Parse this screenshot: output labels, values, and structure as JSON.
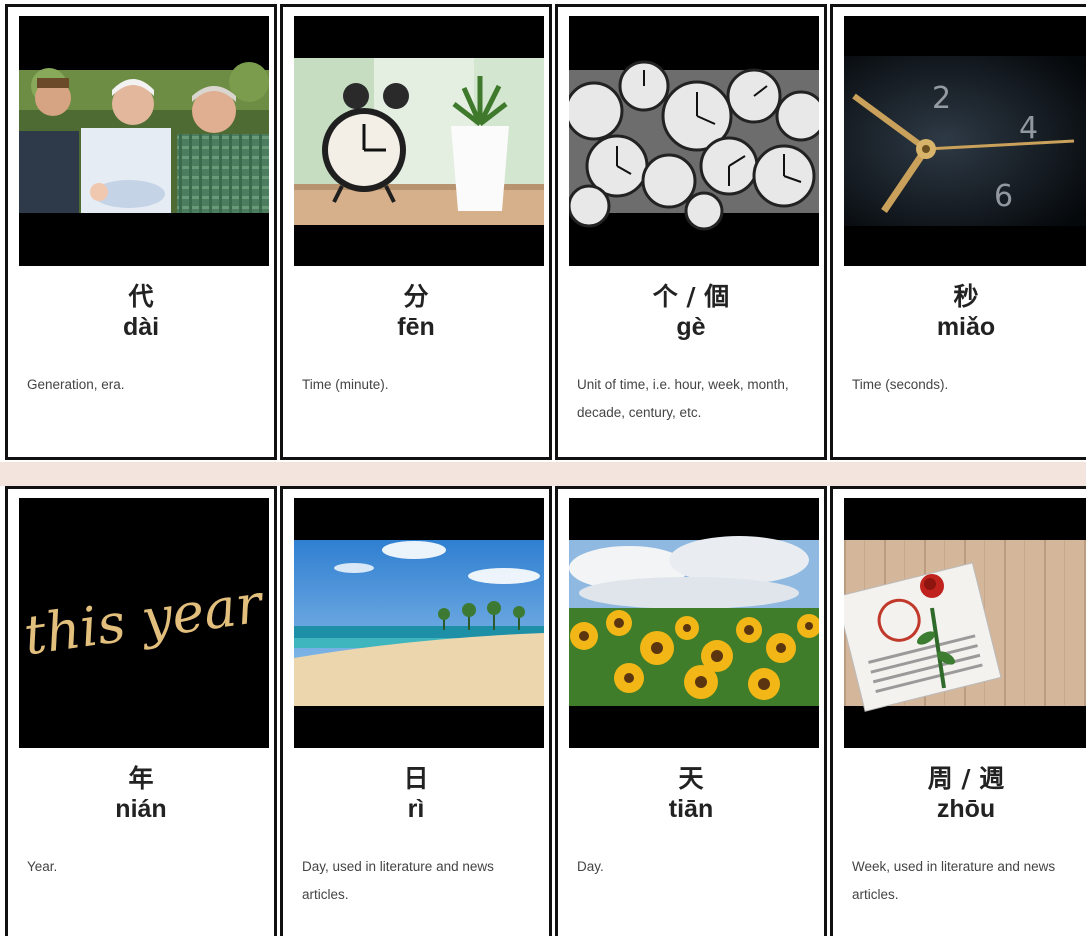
{
  "cards": [
    {
      "hanzi": "代",
      "pinyin": "dài",
      "definition": "Generation, era.",
      "image": "family-photo"
    },
    {
      "hanzi": "分",
      "pinyin": "fēn",
      "definition": "Time (minute).",
      "image": "alarm-clock-photo"
    },
    {
      "hanzi": "个 / 個",
      "pinyin": "gè",
      "definition": "Unit of time, i.e. hour, week, month, decade, century, etc.",
      "image": "many-clocks-photo"
    },
    {
      "hanzi": "秒",
      "pinyin": "miǎo",
      "definition": "Time (seconds).",
      "image": "clock-face-closeup-photo"
    },
    {
      "hanzi": "年",
      "pinyin": "nián",
      "definition": "Year.",
      "image": "this-year-lettering",
      "image_text": "this year"
    },
    {
      "hanzi": "日",
      "pinyin": "rì",
      "definition": "Day, used in literature and news articles.",
      "image": "beach-photo"
    },
    {
      "hanzi": "天",
      "pinyin": "tiān",
      "definition": "Day.",
      "image": "sunflower-field-photo"
    },
    {
      "hanzi": "周 / 週",
      "pinyin": "zhōu",
      "definition": "Week, used in literature and news articles.",
      "image": "calendar-rose-photo"
    }
  ],
  "colors": {
    "card_border": "#111111",
    "band": "#f3e4de",
    "image_background": "#000000",
    "heading_text": "#222222",
    "body_text": "#444444"
  }
}
